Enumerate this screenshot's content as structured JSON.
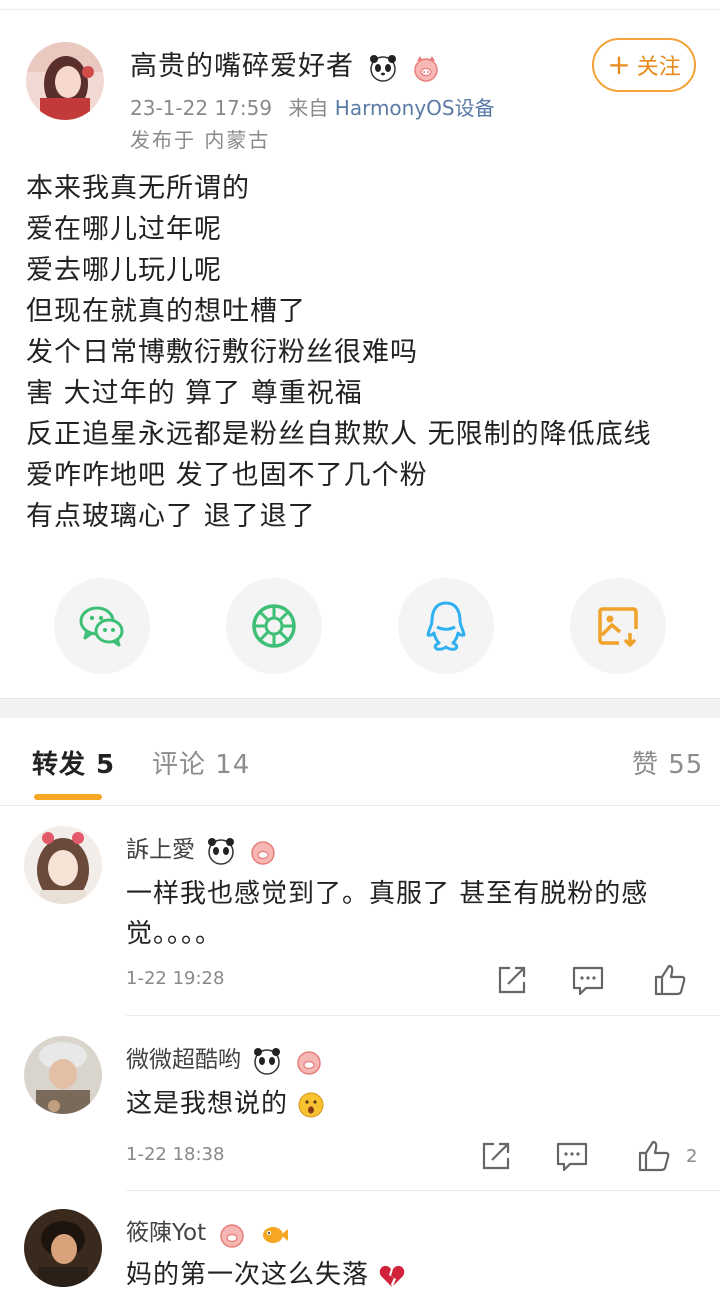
{
  "post": {
    "author": "高贵的嘴碎爱好者",
    "time": "23-1-22 17:59",
    "via_prefix": "来自",
    "device": "HarmonyOS设备",
    "location": "发布于 内蒙古",
    "follow_label": "关注",
    "follow_icon": "+",
    "lines": [
      "本来我真无所谓的",
      "爱在哪儿过年呢",
      "爱去哪儿玩儿呢",
      "但现在就真的想吐槽了",
      "发个日常博敷衍敷衍粉丝很难吗",
      "害 大过年的 算了 尊重祝福",
      "反正追星永远都是粉丝自欺欺人 无限制的降低底线",
      "爱咋咋地吧 发了也固不了几个粉",
      "有点玻璃心了 退了退了"
    ]
  },
  "share": [
    "wechat-icon",
    "moments-icon",
    "qq-icon",
    "save-image-icon"
  ],
  "tabs": {
    "repost": "转发 5",
    "comments": "评论 14",
    "likes": "赞 55"
  },
  "comments": [
    {
      "name": "訴上愛",
      "text": "一样我也感觉到了。真服了 甚至有脱粉的感觉。。。。",
      "time": "1-22 19:28",
      "likes": ""
    },
    {
      "name": "微微超酷哟",
      "text": "这是我想说的",
      "time": "1-22 18:38",
      "likes": "2"
    },
    {
      "name": "筱陳Yot",
      "text": "妈的第一次这么失落",
      "time": "",
      "likes": ""
    }
  ],
  "colors": {
    "accent": "#f5a623",
    "follow": "#e98a1e",
    "device_link": "#5b7aa6",
    "wechat": "#3dbf75",
    "moments": "#3dbf75",
    "qq": "#2fb0f0",
    "save": "#f0a22a"
  }
}
